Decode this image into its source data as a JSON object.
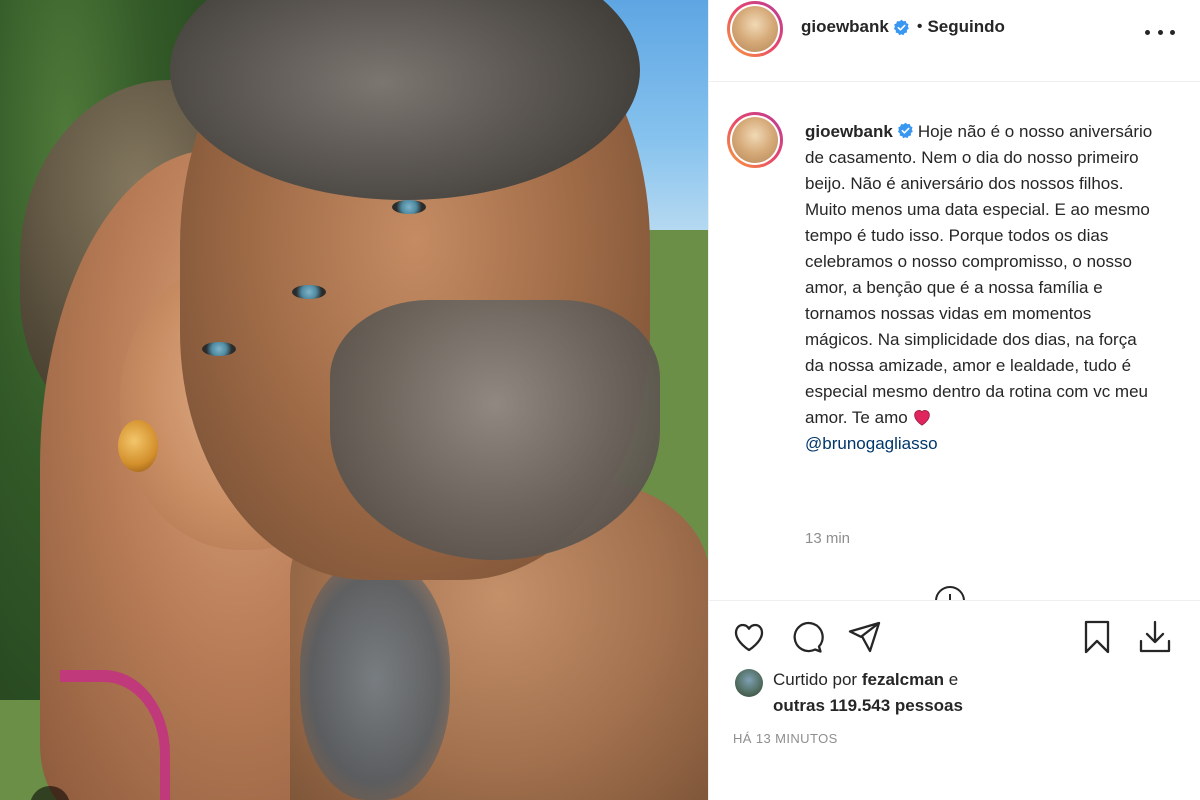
{
  "post": {
    "username": "gioewbank",
    "follow_status": "Seguindo",
    "dot": "•",
    "caption_text": "Hoje não é o nosso aniversário de casamento. Nem o dia do nosso primeiro beijo. Não é aniversário dos nossos filhos. Muito menos uma data especial. E ao mesmo tempo é tudo isso. Porque todos os dias celebramos o nosso compromisso, o nosso amor, a bençāo que é a nossa família e tornamos nossas vidas em momentos mágicos. Na simplicidade dos dias, na força da nossa amizade, amor e lealdade, tudo é especial mesmo dentro da rotina com vc meu amor. Te amo",
    "mention": "@brunogagliasso",
    "caption_time": "13 min",
    "likes": {
      "prefix": "Curtido por",
      "liker": "fezalcman",
      "conjunction": "e",
      "others": "outras 119.543 pessoas"
    },
    "timestamp": "HÁ 13 MINUTOS"
  },
  "icons": {
    "verified": "verified-badge-icon",
    "more": "more-options-icon",
    "like": "heart-icon",
    "comment": "comment-icon",
    "share": "share-icon",
    "save": "bookmark-icon",
    "download": "download-icon",
    "emoji": "red-heart-emoji-icon"
  },
  "colors": {
    "verified_blue": "#3897f0",
    "mention_blue": "#00376b",
    "secondary_text": "#8e8e8e",
    "heart_red": "#e0245e"
  }
}
